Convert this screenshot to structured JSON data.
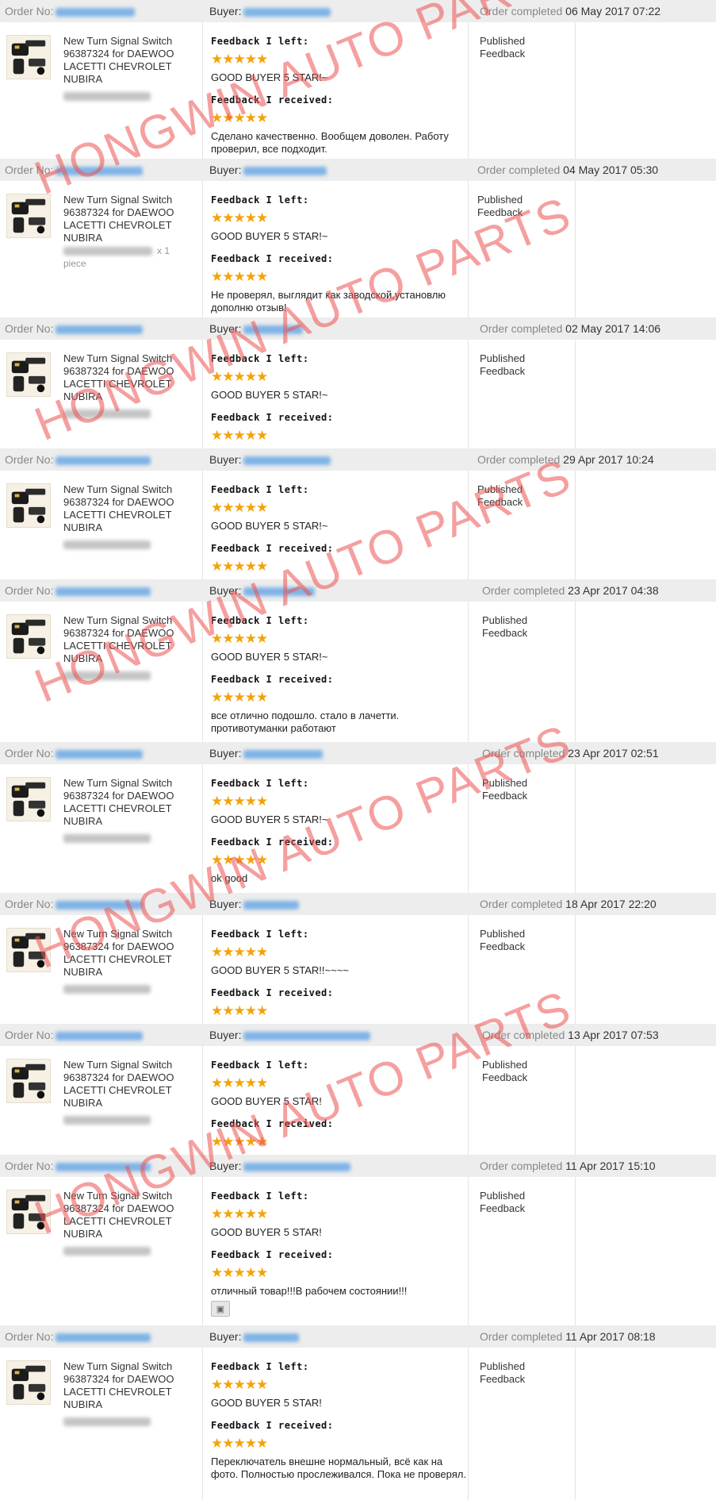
{
  "labels": {
    "order_no": "Order No:",
    "buyer": "Buyer:",
    "order_completed": "Order completed",
    "feedback_left": "Feedback I left:",
    "feedback_received": "Feedback I received:",
    "status_line1": "Published",
    "status_line2": "Feedback",
    "qty_suffix": "x 1",
    "qty_unit": "piece"
  },
  "product_title": "New Turn Signal Switch 96387324 for DAEWOO LACETTI CHEVROLET NUBIRA",
  "watermark": "HONGWIN AUTO PARTS",
  "colors": {
    "header_bg": "#ededed",
    "star": "#f3a30a",
    "link": "#3b7dd8",
    "watermark": "#ec5050"
  },
  "icons": {
    "star": "star-icon",
    "thumbnail": "product-thumbnail-icon",
    "attachment": "photo-attachment-icon"
  },
  "orders": [
    {
      "completed": "06 May 2017 07:22",
      "left_stars": "★★★★★",
      "left_text": "GOOD BUYER 5 STAR!~",
      "received_stars": "★★★★★",
      "received_text": "Сделано качественно. Вообщем доволен. Работу проверил, все подходит."
    },
    {
      "completed": "04 May 2017 05:30",
      "left_stars": "★★★★★",
      "left_text": "GOOD BUYER 5 STAR!~",
      "received_stars": "★★★★★",
      "received_text": "Не проверял, выглядит как заводской,установлю дополню отзыв!"
    },
    {
      "completed": "02 May 2017 14:06",
      "left_stars": "★★★★★",
      "left_text": "GOOD BUYER 5 STAR!~",
      "received_stars": "★★★★★",
      "received_text": ""
    },
    {
      "completed": "29 Apr 2017 10:24",
      "left_stars": "★★★★★",
      "left_text": "GOOD BUYER 5 STAR!~",
      "received_stars": "★★★★★",
      "received_text": ""
    },
    {
      "completed": "23 Apr 2017 04:38",
      "left_stars": "★★★★★",
      "left_text": "GOOD BUYER 5 STAR!~",
      "received_stars": "★★★★★",
      "received_text": "все отлично подошло. стало в лачетти. противотуманки работают"
    },
    {
      "completed": "23 Apr 2017 02:51",
      "left_stars": "★★★★★",
      "left_text": "GOOD BUYER 5 STAR!~",
      "received_stars": "★★★★★",
      "received_text": "ok good"
    },
    {
      "completed": "18 Apr 2017 22:20",
      "left_stars": "★★★★★",
      "left_text": "GOOD BUYER 5 STAR!!~~~~",
      "received_stars": "★★★★★",
      "received_text": ""
    },
    {
      "completed": "13 Apr 2017 07:53",
      "left_stars": "★★★★★",
      "left_text": "GOOD BUYER 5 STAR!",
      "received_stars": "★★★★★",
      "received_text": ""
    },
    {
      "completed": "11 Apr 2017 15:10",
      "left_stars": "★★★★★",
      "left_text": "GOOD BUYER 5 STAR!",
      "received_stars": "★★★★★",
      "received_text": "отличный товар!!!В рабочем состоянии!!!"
    },
    {
      "completed": "11 Apr 2017 08:18",
      "left_stars": "★★★★★",
      "left_text": "GOOD BUYER 5 STAR!",
      "received_stars": "★★★★★",
      "received_text": "Переключатель внешне нормальный, всё как на фото. Полностью прослеживался. Пока не проверял."
    }
  ]
}
